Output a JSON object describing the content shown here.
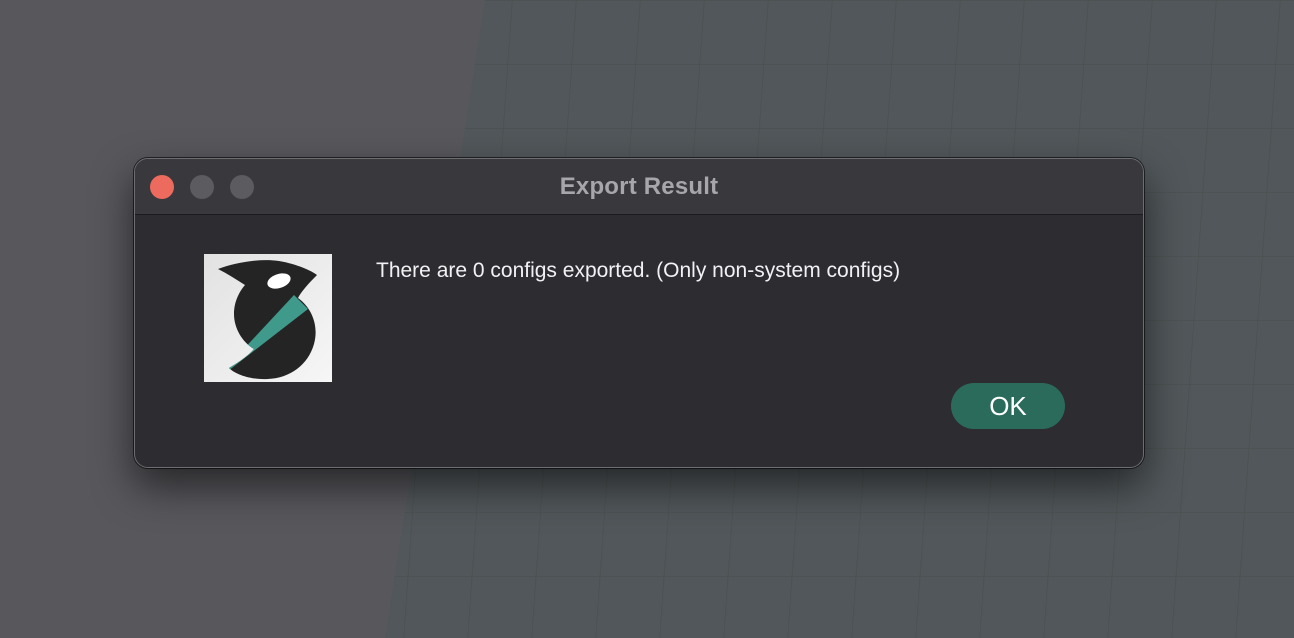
{
  "window": {
    "title": "Export Result",
    "traffic_lights": {
      "close_color": "#ec6a5e",
      "minimize_color": "#5c5b60",
      "zoom_color": "#5c5b60"
    }
  },
  "dialog": {
    "icon": "orca-app-icon",
    "message": "There are 0 configs exported. (Only non-system configs)",
    "ok_label": "OK"
  },
  "colors": {
    "accent": "#2b6b5c",
    "dialog_background": "#2d2c31",
    "desktop_background": "#57575c",
    "icon_teal": "#3f9a8c"
  }
}
